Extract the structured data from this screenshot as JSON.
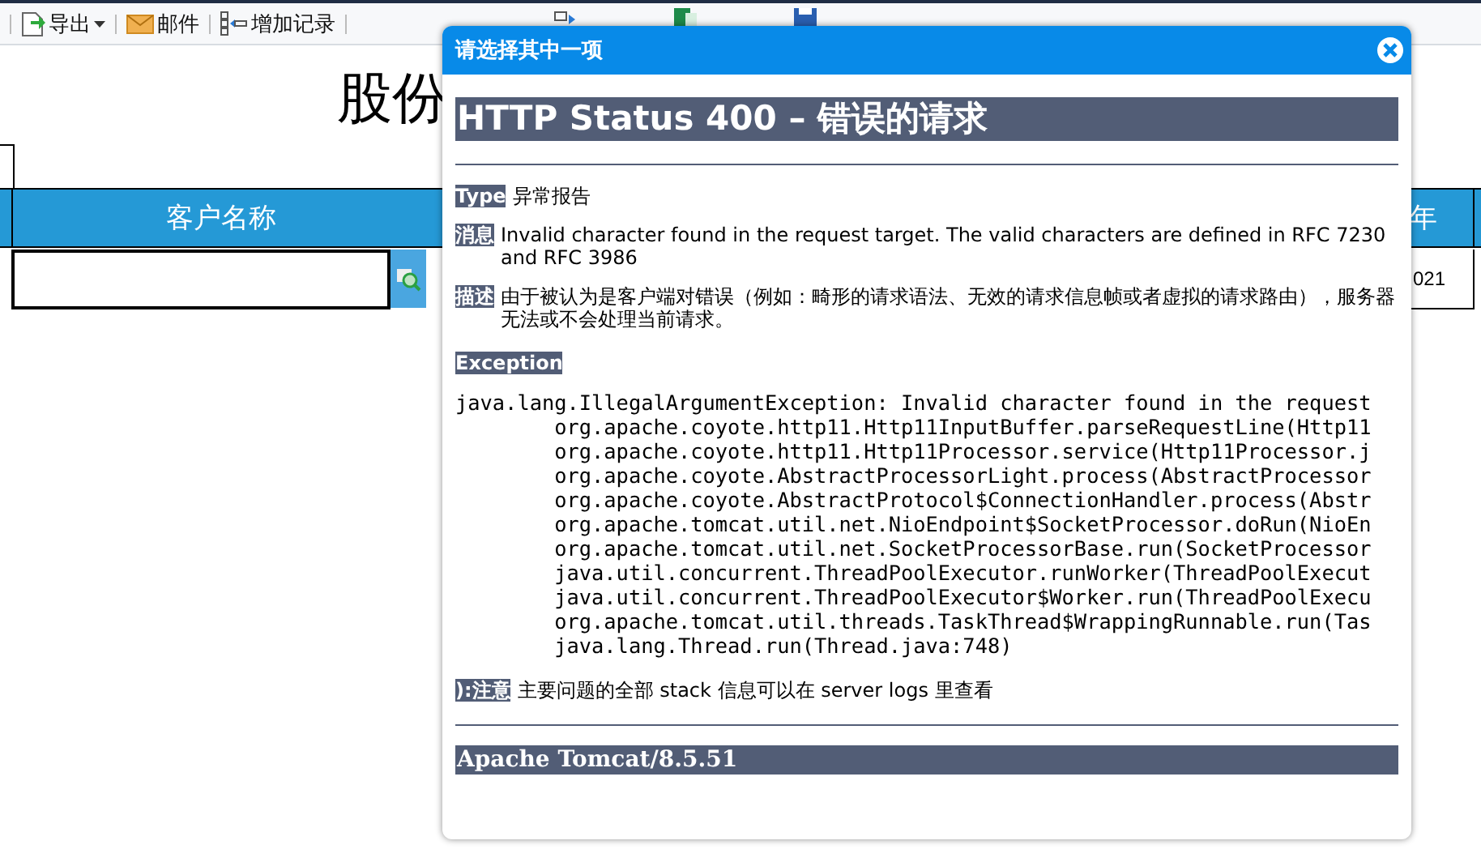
{
  "toolbar": {
    "left": [
      {
        "label": "导出",
        "dropdown": true
      },
      {
        "label": "邮件",
        "dropdown": false
      },
      {
        "label": "增加记录",
        "dropdown": false
      }
    ]
  },
  "report": {
    "title": "股份",
    "columns": [
      "客户名称",
      "年"
    ],
    "cells": [
      "021"
    ]
  },
  "dialog": {
    "title": "请选择其中一项",
    "heading": "HTTP Status 400 – 错误的请求",
    "fields": [
      {
        "label": "Type",
        "text": "异常报告"
      },
      {
        "label": "消息",
        "text": "Invalid character found in the request target. The valid characters are defined in RFC 7230 and RFC 3986"
      },
      {
        "label": "描述",
        "text": "由于被认为是客户端对错误（例如：畸形的请求语法、无效的请求信息帧或者虚拟的请求路由），服务器无法或不会处理当前请求。"
      }
    ],
    "exception_label": "Exception",
    "stack": [
      "java.lang.IllegalArgumentException: Invalid character found in the request",
      "\torg.apache.coyote.http11.Http11InputBuffer.parseRequestLine(Http11",
      "\torg.apache.coyote.http11.Http11Processor.service(Http11Processor.j",
      "\torg.apache.coyote.AbstractProcessorLight.process(AbstractProcessor",
      "\torg.apache.coyote.AbstractProtocol$ConnectionHandler.process(Abstr",
      "\torg.apache.tomcat.util.net.NioEndpoint$SocketProcessor.doRun(NioEn",
      "\torg.apache.tomcat.util.net.SocketProcessorBase.run(SocketProcessor",
      "\tjava.util.concurrent.ThreadPoolExecutor.runWorker(ThreadPoolExecut",
      "\tjava.util.concurrent.ThreadPoolExecutor$Worker.run(ThreadPoolExecu",
      "\torg.apache.tomcat.util.threads.TaskThread$WrappingRunnable.run(Tas",
      "\tjava.lang.Thread.run(Thread.java:748)"
    ],
    "note": {
      "label": "):注意",
      "text": "主要问题的全部 stack 信息可以在 server logs 里查看"
    },
    "footer": "Apache Tomcat/8.5.51"
  }
}
